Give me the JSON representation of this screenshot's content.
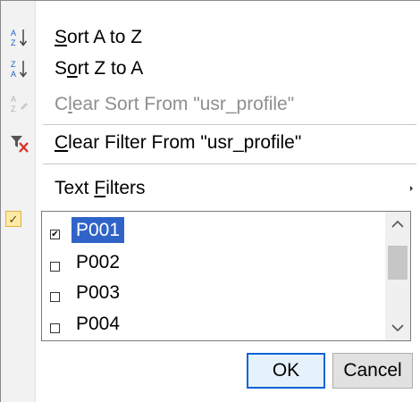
{
  "menu": {
    "items": [
      {
        "prefix": "",
        "accel": "S",
        "rest": "ort A to Z",
        "enabled": true,
        "icon": "sort-ascending-icon"
      },
      {
        "prefix": "S",
        "accel": "o",
        "rest": "rt Z to A",
        "enabled": true,
        "icon": "sort-descending-icon"
      },
      {
        "prefix": "C",
        "accel": "l",
        "rest": "ear Sort From \"usr_profile\"",
        "enabled": false,
        "icon": "clear-sort-icon"
      },
      {
        "prefix": "",
        "accel": "C",
        "rest": "lear Filter From \"usr_profile\"",
        "enabled": true,
        "icon": "clear-filter-icon"
      },
      {
        "prefix": "Text ",
        "accel": "F",
        "rest": "ilters",
        "enabled": true,
        "icon": "",
        "submenu": true
      }
    ]
  },
  "filter_list": {
    "items": [
      {
        "label": "P001",
        "checked": true,
        "selected": true
      },
      {
        "label": "P002",
        "checked": false,
        "selected": false
      },
      {
        "label": "P003",
        "checked": false,
        "selected": false
      },
      {
        "label": "P004",
        "checked": false,
        "selected": false
      }
    ]
  },
  "buttons": {
    "ok": "OK",
    "cancel": "Cancel"
  },
  "glyphs": {
    "check": "✔",
    "gutter_check": "✓",
    "scroll_up": "▲",
    "scroll_down": "▼"
  },
  "colors": {
    "selection": "#2f63c8",
    "disabled_text": "#8e8e8e",
    "gutter_check_bg": "#fde9a8",
    "clear_filter_red": "#d9342b"
  }
}
